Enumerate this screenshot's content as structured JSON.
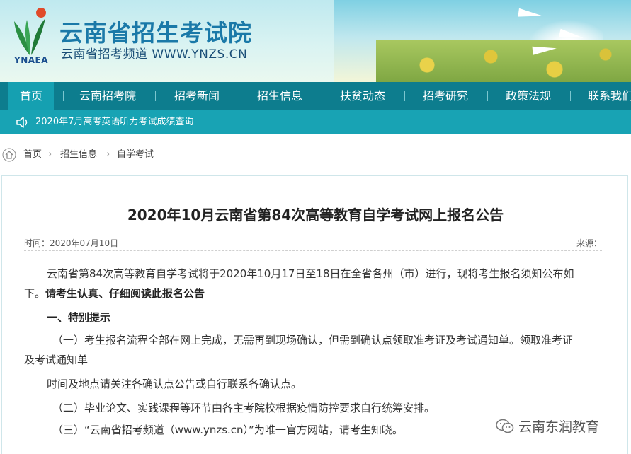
{
  "header": {
    "logo_text": "YNAEA",
    "title": "云南省招生考试院",
    "subtitle": "云南省招考频道 WWW.YNZS.CN"
  },
  "nav": {
    "items": [
      {
        "label": "首页"
      },
      {
        "label": "云南招考院"
      },
      {
        "label": "招考新闻"
      },
      {
        "label": "招生信息"
      },
      {
        "label": "扶贫动态"
      },
      {
        "label": "招考研究"
      },
      {
        "label": "政策法规"
      },
      {
        "label": "联系我们"
      }
    ],
    "active_index": 0
  },
  "notice": {
    "text": "2020年7月高考英语听力考试成绩查询",
    "icon": "speaker-icon"
  },
  "breadcrumb": {
    "items": [
      "首页",
      "招生信息",
      "自学考试"
    ],
    "icon": "home-icon"
  },
  "article": {
    "title": "2020年10月云南省第84次高等教育自学考试网上报名公告",
    "date_text": "时间：2020年07月10日",
    "source_text": "来源：",
    "p1_line1": "云南省第84次高等教育自学考试将于2020年10月17日至18日在全省各州（市）进行，现将考生报名须知公布如",
    "p1_line2_plain": "下。",
    "p1_line2_bold": "请考生认真、仔细阅读此报名公告",
    "section1": "一、特别提示",
    "item1_line1": "（一）考生报名流程全部在网上完成，无需再到现场确认，但需到确认点领取准考证及考试通知单。领取准考证",
    "item1_line2": "及考试通知单",
    "item1_line3": "时间及地点请关注各确认点公告或自行联系各确认点。",
    "item2": "（二）毕业论文、实践课程等环节由各主考院校根据疫情防控要求自行统筹安排。",
    "item3": "（三）“云南省招考频道（www.ynzs.cn）”为唯一官方网站，请考生知晓。"
  },
  "watermark": {
    "text": "云南东润教育",
    "icon": "wechat-icon"
  },
  "colors": {
    "nav_bg": "#0d7d8e",
    "nav_active": "#15a0b1",
    "notice_bg": "#18a3b4",
    "title_blue": "#1a79a8"
  }
}
